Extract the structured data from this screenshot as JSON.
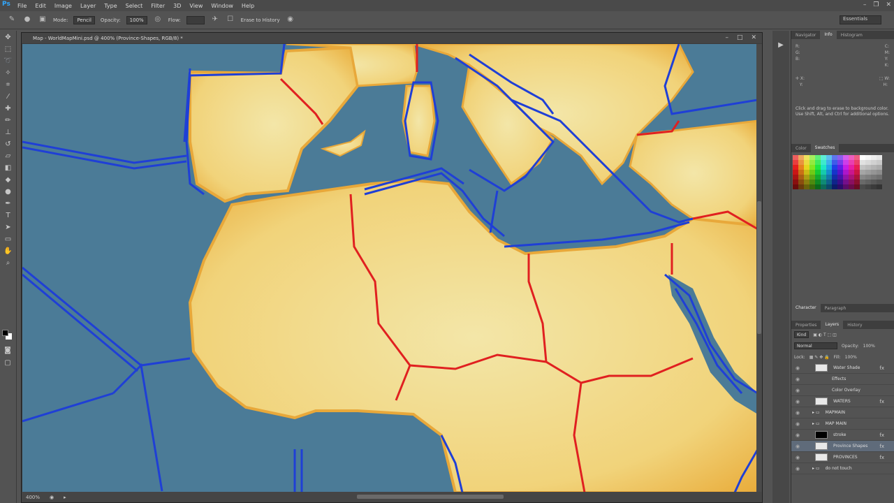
{
  "app": {
    "logo": "Ps"
  },
  "menu": [
    "File",
    "Edit",
    "Image",
    "Layer",
    "Type",
    "Select",
    "Filter",
    "3D",
    "View",
    "Window",
    "Help"
  ],
  "options": {
    "mode_label": "Mode:",
    "mode_value": "Pencil",
    "opacity_label": "Opacity:",
    "opacity_value": "100%",
    "flow_label": "Flow:",
    "erase_label": "Erase to History"
  },
  "workspace": "Essentials",
  "document": {
    "title": "Map - WorldMapMini.psd @ 400% (Province-Shapes, RGB/8) *",
    "zoom": "400%"
  },
  "panels": {
    "top_tabs": [
      "Navigator",
      "Info",
      "Histogram"
    ],
    "active_top_tab": "Info",
    "info_text": "Click and drag to erase to background color. Use Shift, Alt, and Ctrl for additional options.",
    "swatch_tabs": [
      "Color",
      "Swatches"
    ],
    "char_tabs": [
      "Character",
      "Paragraph"
    ],
    "layer_tabs": [
      "Properties",
      "Layers",
      "History"
    ],
    "kind_label": "Kind",
    "blend_mode": "Normal",
    "opacity_label": "Opacity:",
    "opacity_value": "100%",
    "lock_label": "Lock:",
    "fill_label": "Fill:",
    "fill_value": "100%",
    "layers": [
      {
        "name": "Water Shade",
        "thumb": "light",
        "fx": true
      },
      {
        "name": "Effects",
        "thumb": "none"
      },
      {
        "name": "Color Overlay",
        "thumb": "none"
      },
      {
        "name": "WATERS",
        "thumb": "light",
        "fx": true
      },
      {
        "name": "MAPMAIN",
        "thumb": "folder"
      },
      {
        "name": "MAP MAIN",
        "thumb": "folder"
      },
      {
        "name": "stroke",
        "thumb": "black",
        "fx": true
      },
      {
        "name": "Province Shapes",
        "thumb": "light",
        "fx": true,
        "selected": true
      },
      {
        "name": "PROVINCES",
        "thumb": "light",
        "fx": true
      },
      {
        "name": "do not touch",
        "thumb": "folder"
      }
    ]
  },
  "colors": {
    "land": "#f0c45e",
    "land_edge": "#e8a83a",
    "sea": "#4b7b97",
    "border_red": "#e02020",
    "border_blue": "#1f3fd6"
  }
}
